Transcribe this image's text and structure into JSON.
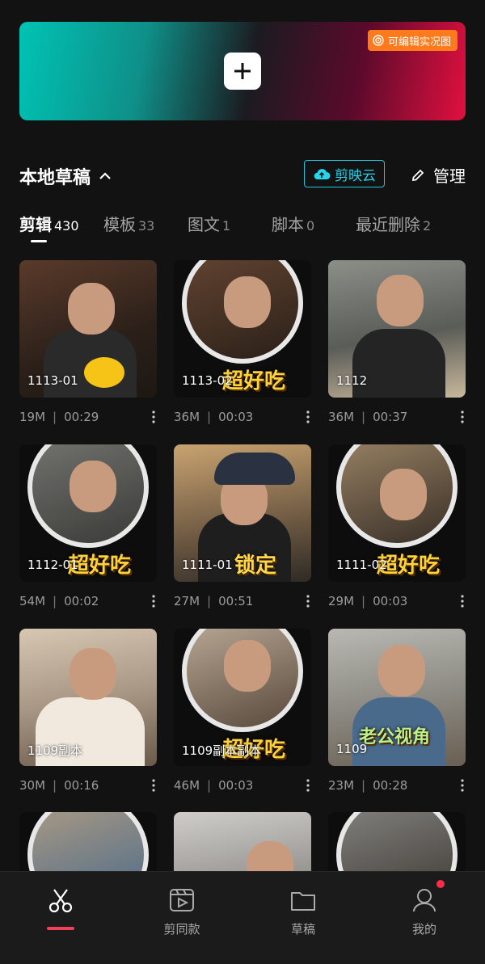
{
  "banner": {
    "live_photo_label": "可编辑实况图",
    "icons": [
      "plus-icon",
      "live-photo-icon"
    ]
  },
  "section": {
    "title": "本地草稿",
    "cloud_label": "剪映云",
    "manage_label": "管理"
  },
  "tabs": [
    {
      "label": "剪辑",
      "count": "430"
    },
    {
      "label": "模板",
      "count": "33"
    },
    {
      "label": "图文",
      "count": "1"
    },
    {
      "label": "脚本",
      "count": "0"
    },
    {
      "label": "最近删除",
      "count": "2"
    }
  ],
  "drafts": [
    {
      "name": "1113-01",
      "size": "19M",
      "duration": "00:29"
    },
    {
      "name": "1113-02",
      "size": "36M",
      "duration": "00:03"
    },
    {
      "name": "1112",
      "size": "36M",
      "duration": "00:37"
    },
    {
      "name": "1112-01",
      "size": "54M",
      "duration": "00:02"
    },
    {
      "name": "1111-01",
      "size": "27M",
      "duration": "00:51"
    },
    {
      "name": "1111-02",
      "size": "29M",
      "duration": "00:03"
    },
    {
      "name": "1109副本",
      "size": "30M",
      "duration": "00:16"
    },
    {
      "name": "1109副本副本",
      "size": "46M",
      "duration": "00:03"
    },
    {
      "name": "1109",
      "size": "23M",
      "duration": "00:28"
    },
    {
      "name": "",
      "size": "",
      "duration": ""
    },
    {
      "name": "",
      "size": "",
      "duration": ""
    },
    {
      "name": "",
      "size": "",
      "duration": ""
    }
  ],
  "stickers": [
    "超好吃",
    "超好吃",
    "锁定",
    "超好吃",
    "超好吃",
    "老公视角"
  ],
  "nav": [
    {
      "label": "",
      "icon": "scissors-icon"
    },
    {
      "label": "剪同款",
      "icon": "template-icon"
    },
    {
      "label": "草稿",
      "icon": "folder-icon"
    },
    {
      "label": "我的",
      "icon": "user-icon"
    }
  ],
  "colors": {
    "accent": "#f2415c",
    "cloud": "#1fc6dd",
    "live": "#ff7a1a"
  }
}
